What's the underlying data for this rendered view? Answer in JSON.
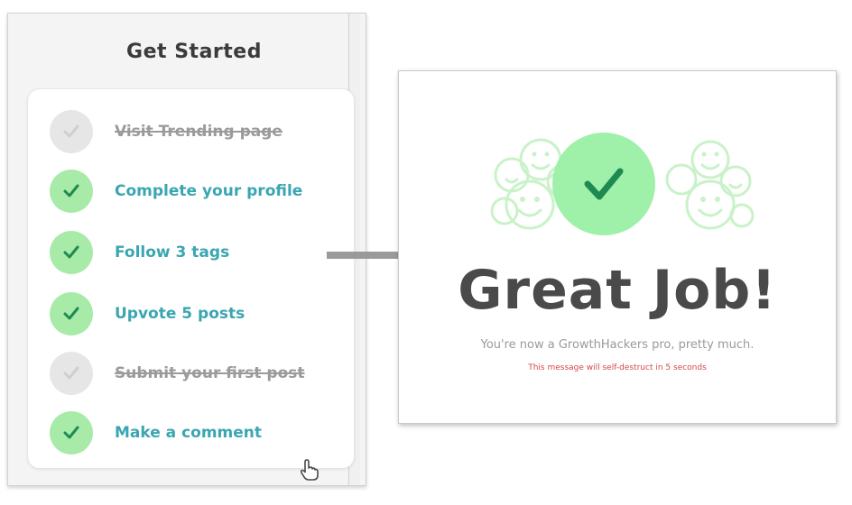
{
  "left_panel": {
    "title": "Get Started",
    "tasks": [
      {
        "label": "Visit Trending page",
        "status": "skipped"
      },
      {
        "label": "Complete your profile",
        "status": "done"
      },
      {
        "label": "Follow 3 tags",
        "status": "done"
      },
      {
        "label": "Upvote 5 posts",
        "status": "done"
      },
      {
        "label": "Submit your first post",
        "status": "skipped"
      },
      {
        "label": "Make a comment",
        "status": "done"
      }
    ]
  },
  "modal": {
    "heading": "Great Job!",
    "subtext": "You're now a GrowthHackers pro, pretty much.",
    "note": "This message will self-destruct in 5 seconds"
  },
  "icons": {
    "check": "check-icon",
    "arrow": "arrow-right-icon",
    "cursor": "hand-cursor-icon",
    "smiley": "smiley-icon"
  },
  "colors": {
    "done_circle": "#a8eba8",
    "skipped_circle": "#e6e6e6",
    "done_text": "#3aa6b1",
    "skipped_text": "#9b9b9b",
    "check_mark": "#1e8a52",
    "heading": "#4a4a4a",
    "note": "#d54848"
  }
}
